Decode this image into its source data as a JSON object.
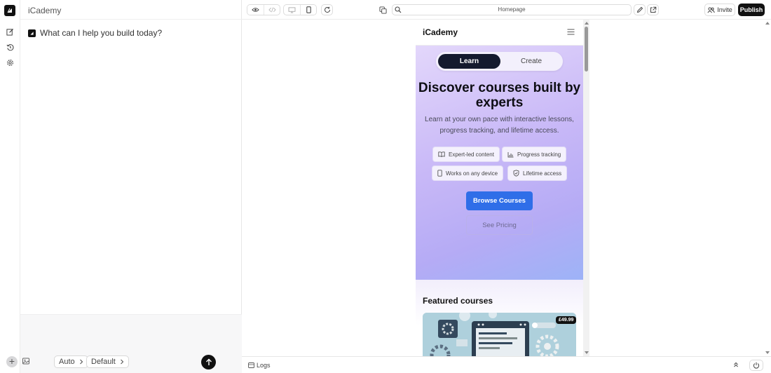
{
  "rail": {
    "icons": [
      "app-logo-icon",
      "edit-icon",
      "history-icon",
      "settings-icon"
    ]
  },
  "chat": {
    "title": "iCademy",
    "messages": [
      {
        "text": "What can I help you build today?"
      }
    ],
    "composer": {
      "mode_label": "Auto",
      "model_label": "Default"
    }
  },
  "toolbar": {
    "url": "Homepage",
    "invite_label": "Invite",
    "publish_label": "Publish"
  },
  "preview": {
    "brand": "iCademy",
    "segment": {
      "active": "Learn",
      "inactive": "Create"
    },
    "hero_title": "Discover courses built by experts",
    "hero_subtitle": "Learn at your own pace with interactive lessons, progress tracking, and lifetime access.",
    "features": [
      {
        "label": "Expert-led content",
        "icon": "book-icon"
      },
      {
        "label": "Progress tracking",
        "icon": "bar-chart-icon"
      },
      {
        "label": "Works on any device",
        "icon": "phone-icon"
      },
      {
        "label": "Lifetime access",
        "icon": "shield-icon"
      }
    ],
    "primary_cta": "Browse Courses",
    "secondary_cta": "See Pricing",
    "featured_title": "Featured courses",
    "course_price": "£49.99"
  },
  "bottom": {
    "logs_label": "Logs"
  },
  "colors": {
    "accent_blue": "#2f6ee8",
    "dark": "#111111",
    "hero_lavender": "#c8b8f7"
  }
}
